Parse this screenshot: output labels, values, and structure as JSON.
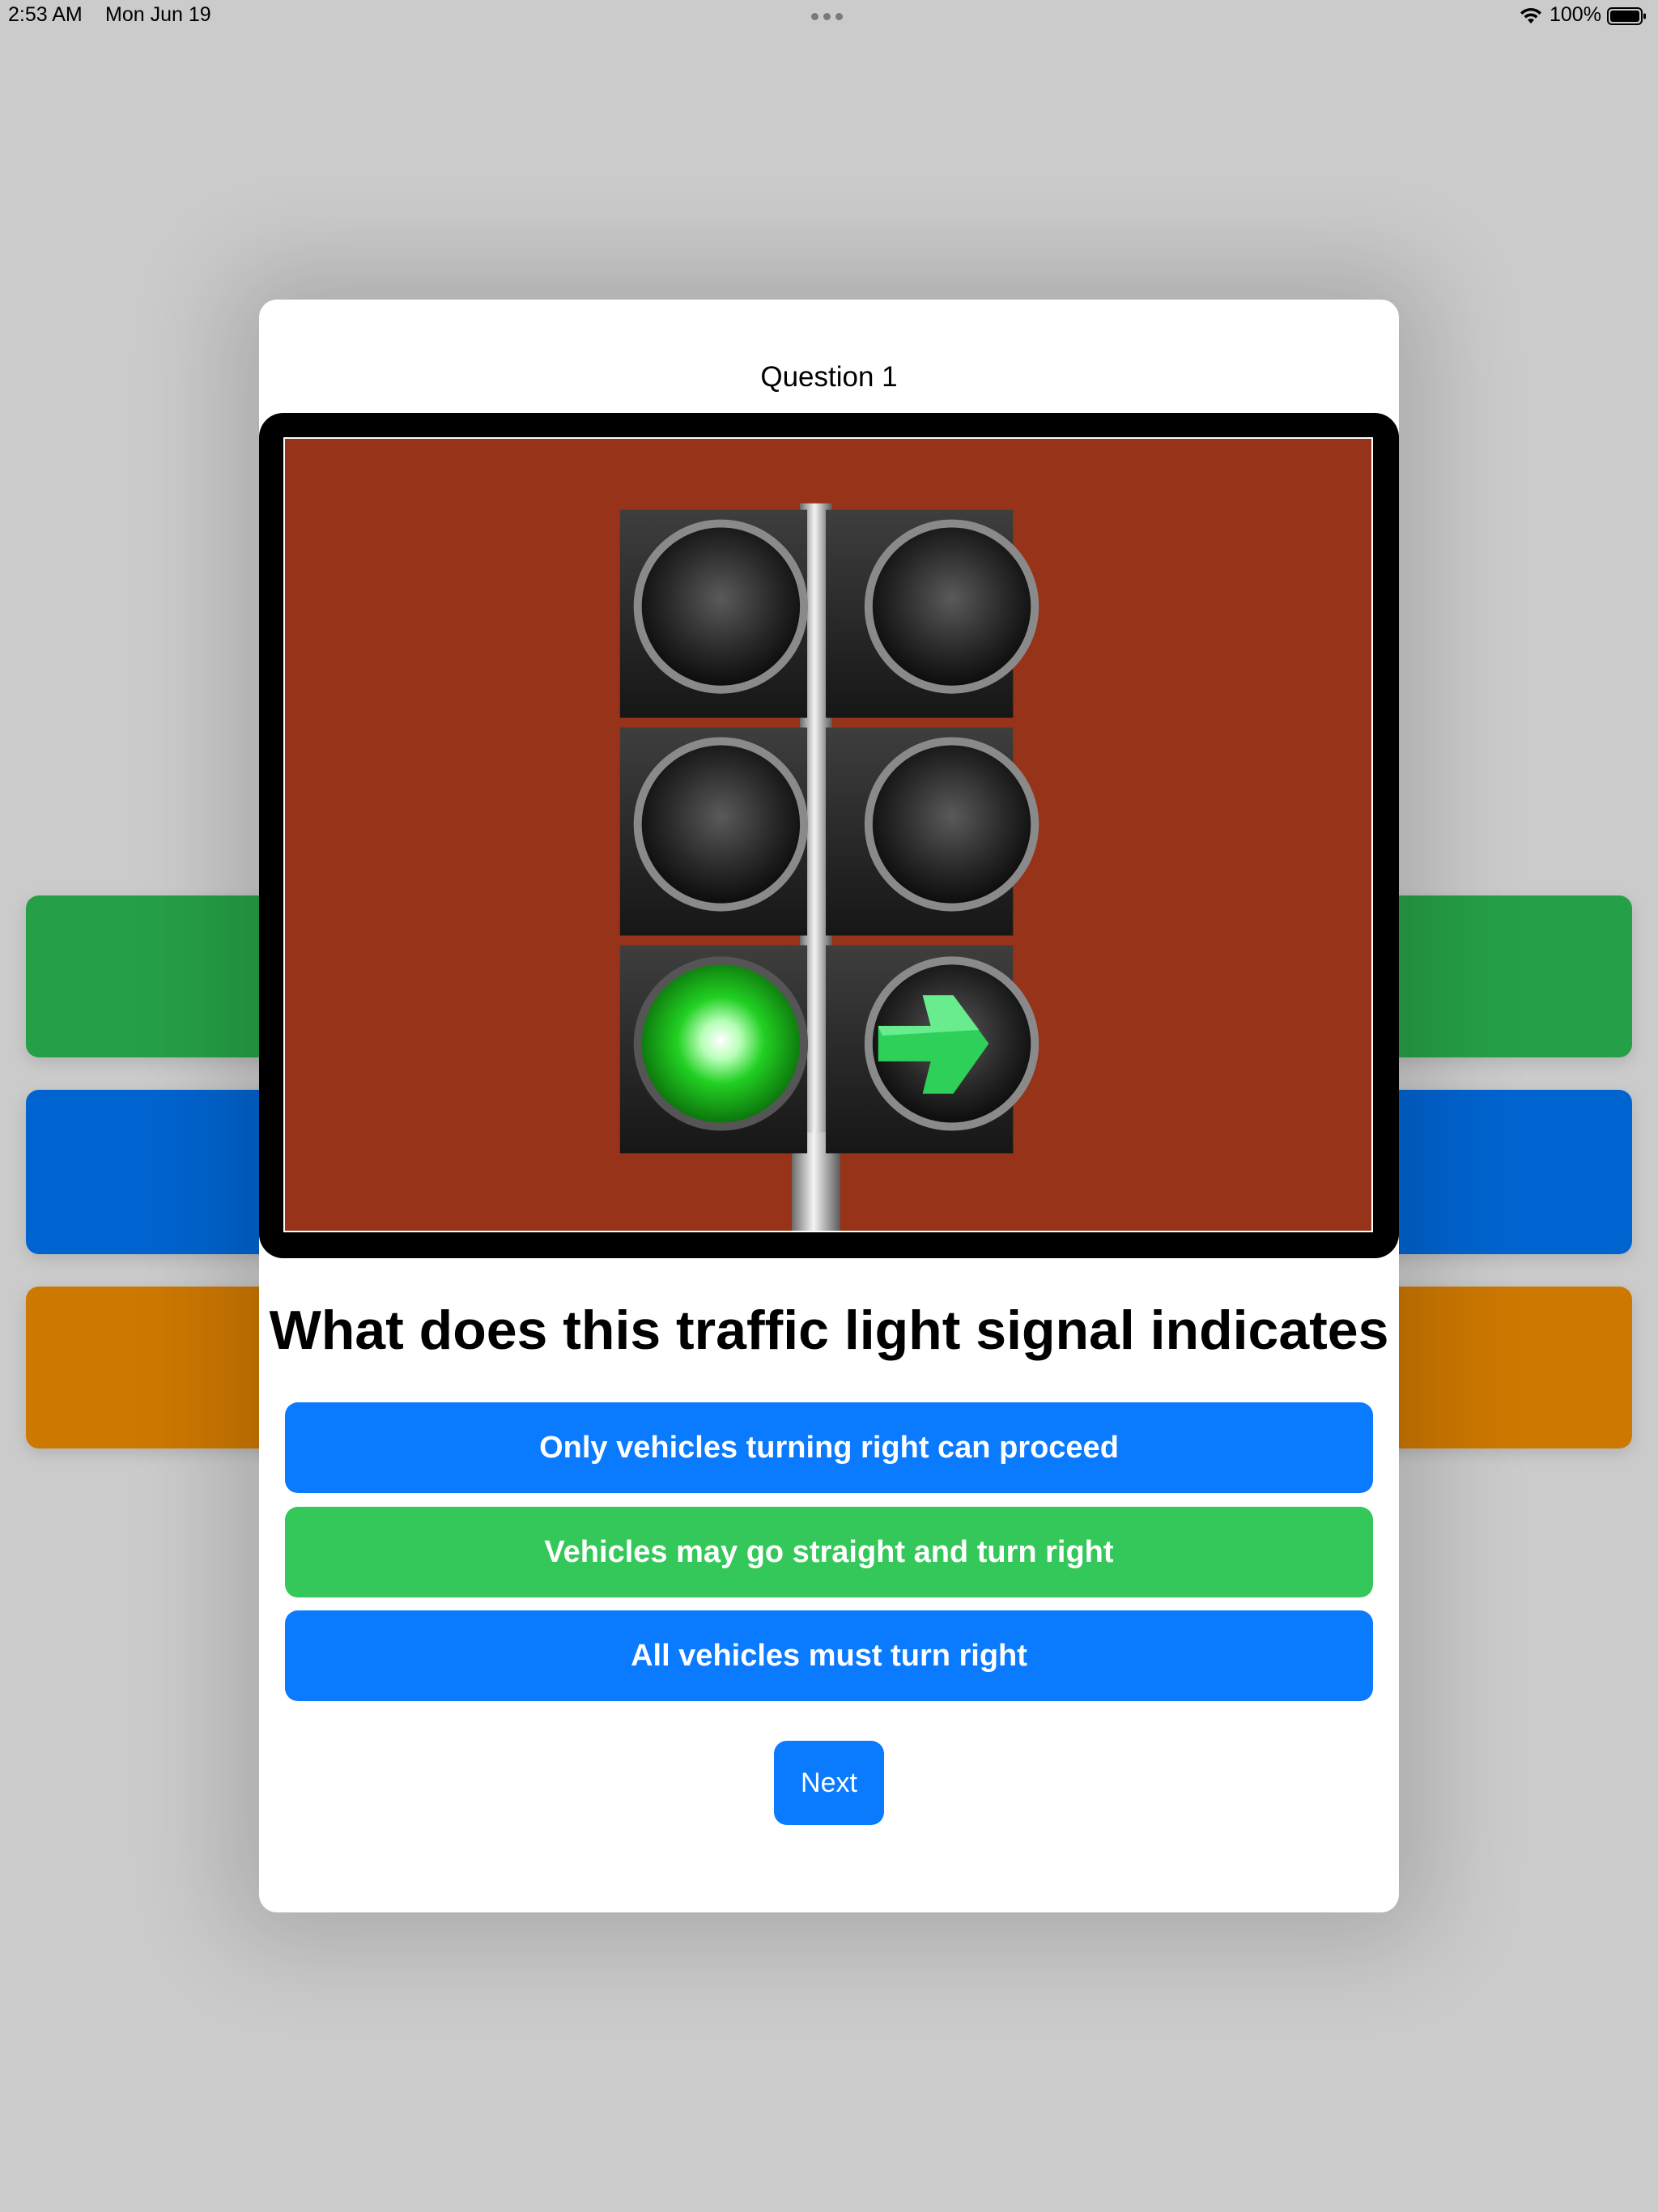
{
  "status_bar": {
    "time": "2:53 AM",
    "date": "Mon Jun 19",
    "battery_percent": "100%",
    "icons": [
      "multitask-dots-icon",
      "wifi-icon",
      "battery-icon"
    ]
  },
  "background": {
    "bars": [
      {
        "name": "green-bar",
        "color": "#26a046"
      },
      {
        "name": "blue-bar",
        "color": "#0064d0"
      },
      {
        "name": "orange-bar",
        "color": "#cd7800"
      }
    ]
  },
  "quiz": {
    "question_number": "Question 1",
    "image": {
      "description_icon": "traffic-light-green-arrow-image",
      "background_color": "#973319"
    },
    "question_text": "What does this traffic light signal indicates",
    "answers": [
      {
        "label": "Only vehicles turning right can proceed",
        "color": "#0a7aff"
      },
      {
        "label": "Vehicles may go straight and turn right",
        "color": "#34c85a"
      },
      {
        "label": "All vehicles must turn right",
        "color": "#0a7aff"
      }
    ],
    "next_label": "Next"
  }
}
